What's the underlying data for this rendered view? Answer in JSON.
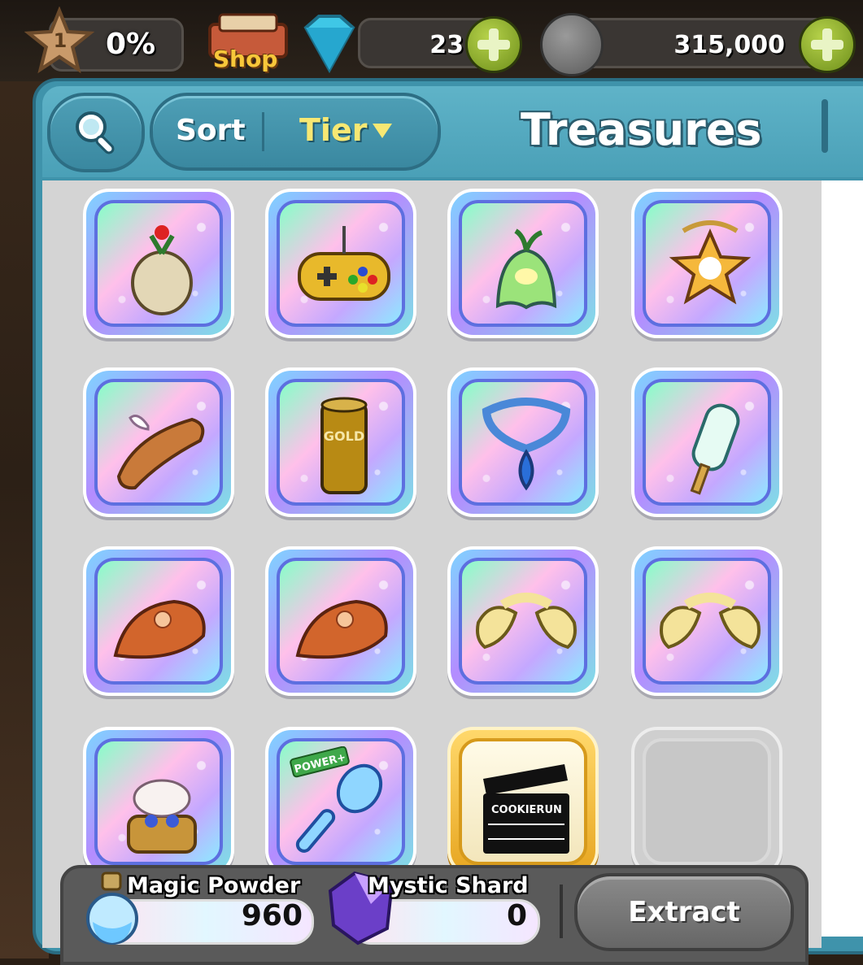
{
  "top_bar": {
    "level": "1",
    "level_progress": "0%",
    "shop_label": "Shop",
    "gems": "23",
    "coins": "315,000",
    "icons": [
      "star-icon",
      "shop-icon",
      "gem-icon",
      "coin-icon",
      "plus-icon"
    ]
  },
  "toolbar": {
    "sort_label": "Sort",
    "sort_value": "Tier",
    "title": "Treasures",
    "icons": [
      "search-icon",
      "dropdown-arrow-icon"
    ]
  },
  "treasures": [
    {
      "icon": "mandrake-root-icon",
      "rarity": "legendary"
    },
    {
      "icon": "gold-game-controller-icon",
      "rarity": "legendary"
    },
    {
      "icon": "rainbow-bell-flower-icon",
      "rarity": "legendary"
    },
    {
      "icon": "star-pendant-icon",
      "rarity": "legendary"
    },
    {
      "icon": "winged-bread-icon",
      "rarity": "legendary"
    },
    {
      "icon": "gold-can-icon",
      "rarity": "legendary",
      "can_text": "GOLD"
    },
    {
      "icon": "water-drop-necklace-icon",
      "rarity": "legendary"
    },
    {
      "icon": "popsicle-icon",
      "rarity": "legendary"
    },
    {
      "icon": "rose-hat-icon",
      "rarity": "legendary"
    },
    {
      "icon": "rose-hat-icon",
      "rarity": "legendary"
    },
    {
      "icon": "cream-ornament-icon",
      "rarity": "legendary"
    },
    {
      "icon": "cream-ornament-icon",
      "rarity": "legendary"
    },
    {
      "icon": "unicorn-music-box-icon",
      "rarity": "legendary"
    },
    {
      "icon": "crystal-spoon-icon",
      "rarity": "legendary",
      "badge": "POWER+"
    },
    {
      "icon": "clapperboard-icon",
      "rarity": "epic",
      "clapper_text": "COOKIERUN"
    },
    {
      "icon": "empty-slot",
      "rarity": "empty"
    }
  ],
  "bottom_bar": {
    "magic_powder_label": "Magic Powder",
    "magic_powder_value": "960",
    "mystic_shard_label": "Mystic Shard",
    "mystic_shard_value": "0",
    "extract_label": "Extract",
    "icons": [
      "magic-powder-potion-icon",
      "mystic-shard-crystal-icon"
    ]
  }
}
